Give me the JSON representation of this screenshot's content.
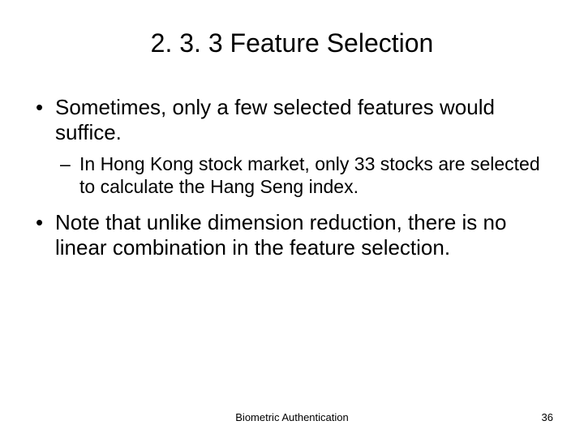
{
  "title": "2. 3. 3 Feature Selection",
  "bullets": [
    {
      "text": "Sometimes, only a few selected features would suffice.",
      "sub": [
        "In Hong Kong stock market, only 33 stocks are selected to calculate the Hang Seng index."
      ]
    },
    {
      "text": "Note that unlike dimension reduction, there is no linear combination in the feature selection.",
      "sub": []
    }
  ],
  "footer": "Biometric Authentication",
  "page_number": "36"
}
